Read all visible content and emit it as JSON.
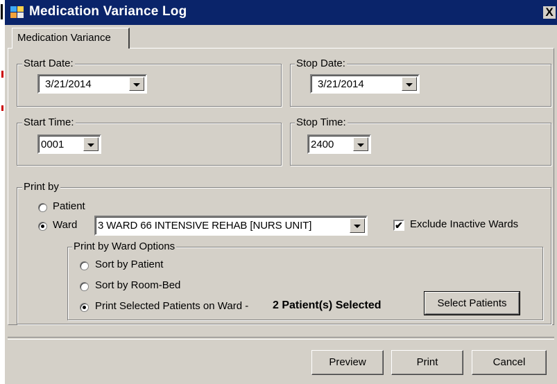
{
  "window": {
    "title": "Medication Variance Log",
    "close_glyph": "X"
  },
  "tab": {
    "label": "Medication Variance"
  },
  "start_date": {
    "label": "Start Date:",
    "value": "3/21/2014"
  },
  "stop_date": {
    "label": "Stop Date:",
    "value": "3/21/2014"
  },
  "start_time": {
    "label": "Start Time:",
    "value": "0001"
  },
  "stop_time": {
    "label": "Stop Time:",
    "value": "2400"
  },
  "print_by": {
    "label": "Print by",
    "patient_label": "Patient",
    "ward_label": "Ward",
    "selected": "ward",
    "ward_value": "3 WARD 66 INTENSIVE REHAB [NURS UNIT]",
    "exclude_inactive_label": "Exclude Inactive Wards",
    "exclude_inactive_checked": true
  },
  "ward_options": {
    "label": "Print by Ward Options",
    "sort_patient_label": "Sort by Patient",
    "sort_room_label": "Sort by Room-Bed",
    "print_selected_label": "Print Selected Patients on Ward -",
    "selected_count_text": "2 Patient(s) Selected",
    "selected": "print_selected",
    "select_patients_label": "Select Patients"
  },
  "buttons": {
    "preview": "Preview",
    "print": "Print",
    "cancel": "Cancel"
  },
  "icons": {
    "app": "app-icon",
    "check_glyph": "✔"
  }
}
